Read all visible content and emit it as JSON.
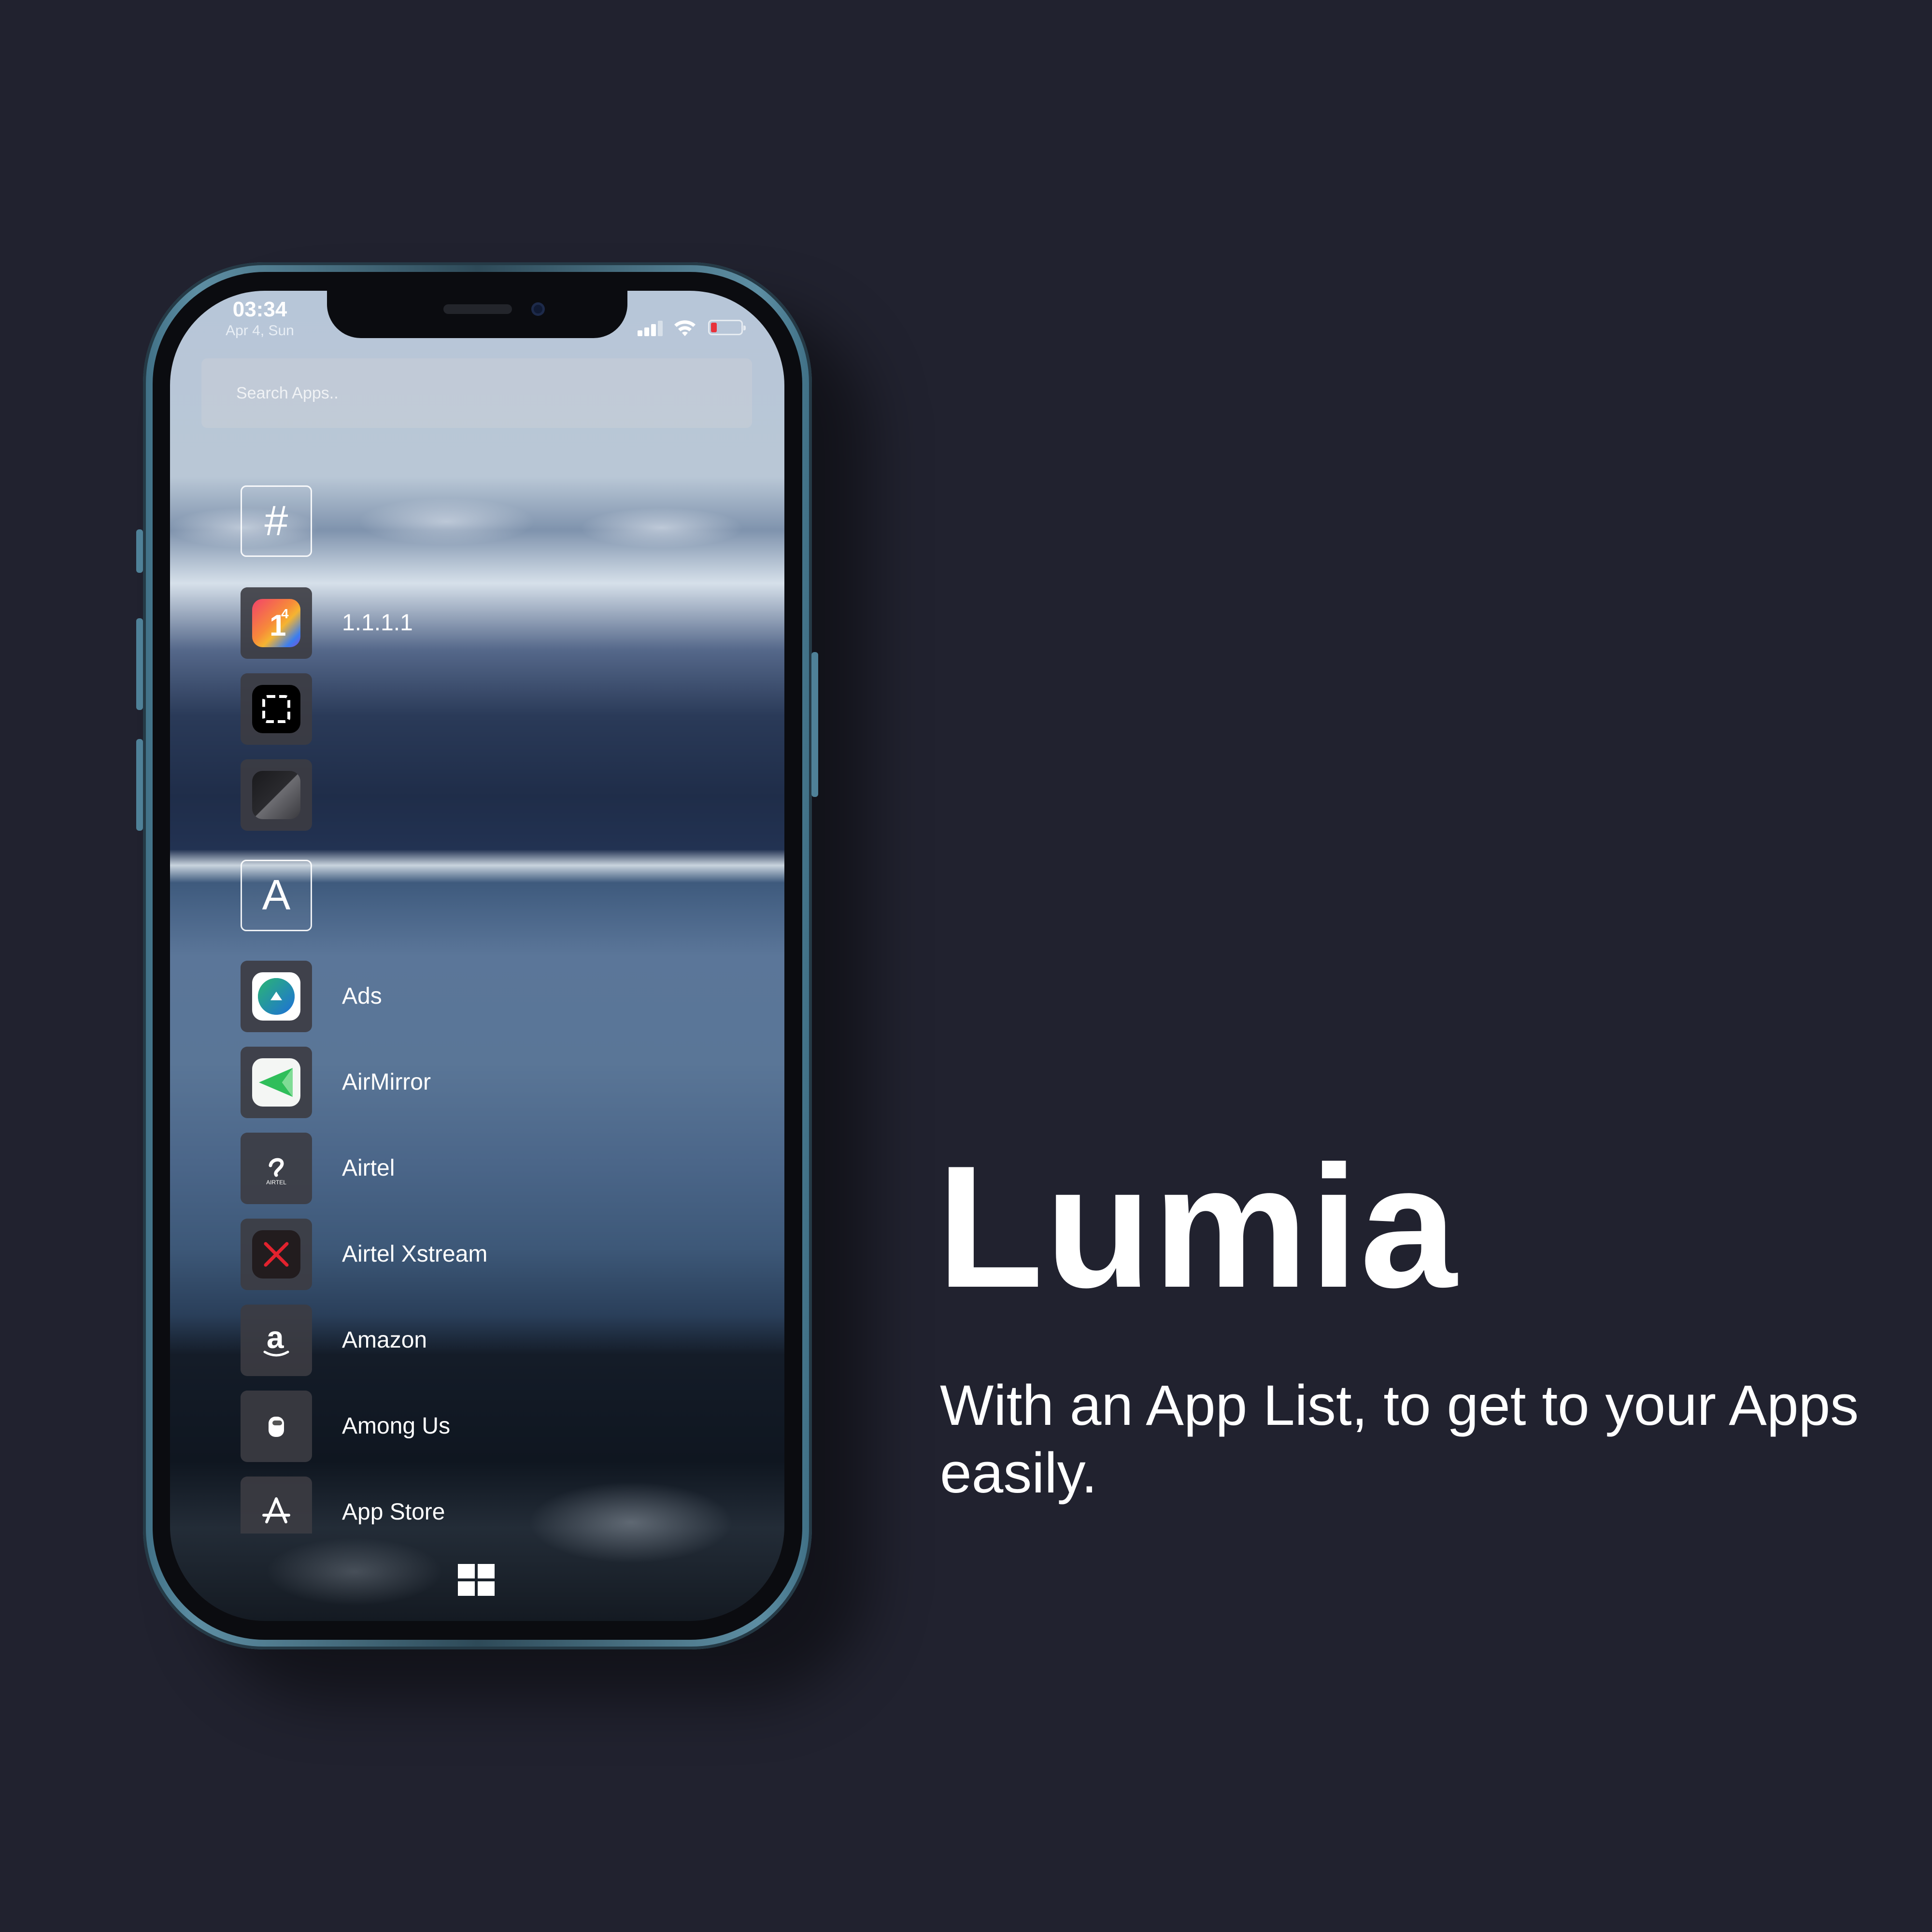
{
  "status_bar": {
    "time": "03:34",
    "date": "Apr 4, Sun"
  },
  "search": {
    "placeholder": "Search Apps.."
  },
  "sections": [
    {
      "letter": "#",
      "apps": [
        {
          "label": "1.1.1.1",
          "icon": "one-one-one-one-icon"
        },
        {
          "label": "",
          "icon": "screenshot-frame-icon"
        },
        {
          "label": "",
          "icon": "dark-gradient-app-icon"
        }
      ]
    },
    {
      "letter": "A",
      "apps": [
        {
          "label": "Ads",
          "icon": "ads-icon"
        },
        {
          "label": "AirMirror",
          "icon": "airmirror-icon"
        },
        {
          "label": "Airtel",
          "icon": "airtel-icon"
        },
        {
          "label": "Airtel Xstream",
          "icon": "airtel-xstream-icon"
        },
        {
          "label": "Amazon",
          "icon": "amazon-icon"
        },
        {
          "label": "Among Us",
          "icon": "among-us-icon"
        },
        {
          "label": "App Store",
          "icon": "app-store-icon"
        }
      ]
    }
  ],
  "airtel_icon_text": "AIRTEL",
  "promo": {
    "title": "Lumia",
    "subtitle": "With an App List, to get to your Apps easily."
  },
  "colors": {
    "background": "#21222f",
    "frame": "#5d8ea3",
    "battery_low": "#e8323a"
  }
}
